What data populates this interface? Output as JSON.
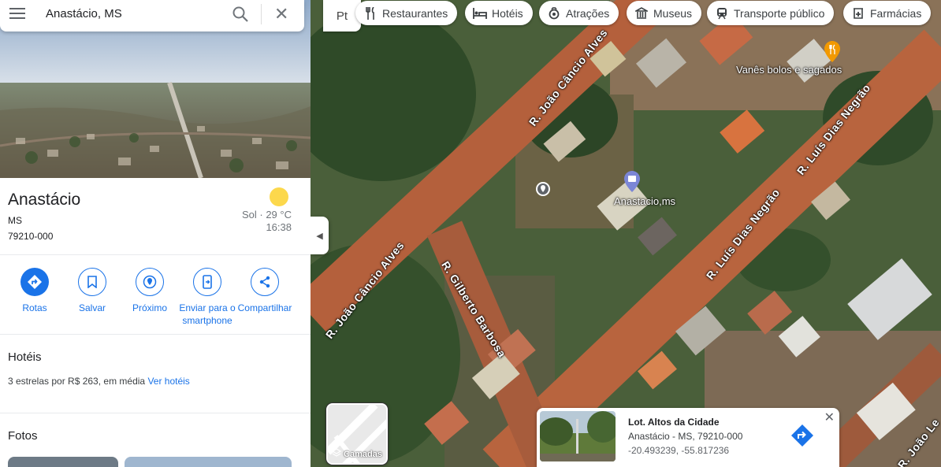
{
  "search": {
    "query": "Anastácio, MS"
  },
  "place": {
    "name": "Anastácio",
    "state": "MS",
    "zip": "79210-000",
    "weather_condition": "Sol",
    "temperature": "29 °C",
    "time": "16:38"
  },
  "actions": [
    {
      "label": "Rotas"
    },
    {
      "label": "Salvar"
    },
    {
      "label": "Próximo"
    },
    {
      "label_line1": "Enviar para o",
      "label_line2": "smartphone"
    },
    {
      "label": "Compartilhar"
    }
  ],
  "hotels": {
    "title": "Hotéis",
    "summary": "3 estrelas por R$ 263, em média",
    "link": "Ver hotéis"
  },
  "photos": {
    "title": "Fotos"
  },
  "map": {
    "mode_label": "Pt",
    "chips": [
      {
        "label": "Restaurantes",
        "icon": "fork-knife-icon"
      },
      {
        "label": "Hotéis",
        "icon": "bed-icon"
      },
      {
        "label": "Atrações",
        "icon": "camera-icon"
      },
      {
        "label": "Museus",
        "icon": "museum-icon"
      },
      {
        "label": "Transporte público",
        "icon": "train-icon"
      },
      {
        "label": "Farmácias",
        "icon": "pharmacy-icon"
      }
    ],
    "streets": [
      {
        "name": "R. João Câncio Alves"
      },
      {
        "name": "R. Luís Dias Negrão"
      },
      {
        "name": "R. Luís Dias Negrão"
      },
      {
        "name": "R. Gilberto Barbosa"
      },
      {
        "name": "R. João Câncio Alves"
      },
      {
        "name": "R. João Le"
      }
    ],
    "pois": [
      {
        "name": "Vanês bolos e sagados"
      },
      {
        "name": "Anastacio,ms"
      }
    ],
    "layers_label": "Camadas",
    "card": {
      "title": "Lot. Altos da Cidade",
      "address": "Anastácio - MS, 79210-000",
      "coords": "-20.493239, -55.817236"
    }
  },
  "colors": {
    "accent": "#1a73e8",
    "road": "#b8603a",
    "vegetation": "#3f5a34"
  }
}
